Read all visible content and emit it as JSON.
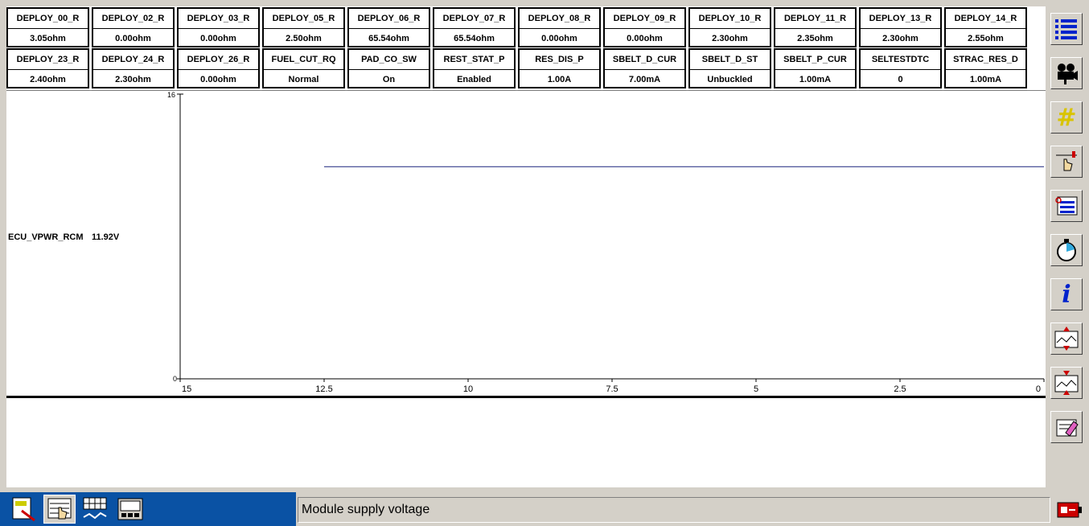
{
  "pids": [
    {
      "name": "DEPLOY_00_R",
      "value": "3.05ohm"
    },
    {
      "name": "DEPLOY_02_R",
      "value": "0.00ohm"
    },
    {
      "name": "DEPLOY_03_R",
      "value": "0.00ohm"
    },
    {
      "name": "DEPLOY_05_R",
      "value": "2.50ohm"
    },
    {
      "name": "DEPLOY_06_R",
      "value": "65.54ohm"
    },
    {
      "name": "DEPLOY_07_R",
      "value": "65.54ohm"
    },
    {
      "name": "DEPLOY_08_R",
      "value": "0.00ohm"
    },
    {
      "name": "DEPLOY_09_R",
      "value": "0.00ohm"
    },
    {
      "name": "DEPLOY_10_R",
      "value": "2.30ohm"
    },
    {
      "name": "DEPLOY_11_R",
      "value": "2.35ohm"
    },
    {
      "name": "DEPLOY_13_R",
      "value": "2.30ohm"
    },
    {
      "name": "DEPLOY_14_R",
      "value": "2.55ohm"
    },
    {
      "name": "DEPLOY_23_R",
      "value": "2.40ohm"
    },
    {
      "name": "DEPLOY_24_R",
      "value": "2.30ohm"
    },
    {
      "name": "DEPLOY_26_R",
      "value": "0.00ohm"
    },
    {
      "name": "FUEL_CUT_RQ",
      "value": "Normal"
    },
    {
      "name": "PAD_CO_SW",
      "value": "On"
    },
    {
      "name": "REST_STAT_P",
      "value": "Enabled"
    },
    {
      "name": "RES_DIS_P",
      "value": "1.00A"
    },
    {
      "name": "SBELT_D_CUR",
      "value": "7.00mA"
    },
    {
      "name": "SBELT_D_ST",
      "value": "Unbuckled"
    },
    {
      "name": "SBELT_P_CUR",
      "value": "1.00mA"
    },
    {
      "name": "SELTESTDTC",
      "value": "0"
    },
    {
      "name": "STRAC_RES_D",
      "value": "1.00mA"
    }
  ],
  "signal": {
    "label": "ECU_VPWR_RCM",
    "value": "11.92V"
  },
  "chart_data": {
    "type": "line",
    "series": [
      {
        "x": [
          12.5,
          0
        ],
        "y": [
          11.92,
          11.92
        ]
      }
    ],
    "ylim": [
      0,
      16
    ],
    "xlim": [
      15,
      0
    ],
    "x_ticks": [
      "15",
      "12.5",
      "10",
      "7.5",
      "5",
      "2.5",
      "0"
    ],
    "y_ticks": [
      "16",
      "0"
    ],
    "line_color": "#1a237e"
  },
  "status": {
    "text": "Module supply voltage"
  },
  "toolbar_icons": [
    "list-icon",
    "camera-icon",
    "hash-icon",
    "pointer-ruler-icon",
    "document-list-icon",
    "stopwatch-icon",
    "info-icon",
    "zoom-in-graph-icon",
    "zoom-out-graph-icon",
    "erase-icon"
  ],
  "taskbar_tabs": [
    "search-tool-icon",
    "datalogger-icon",
    "table-view-icon",
    "recorder-icon"
  ]
}
